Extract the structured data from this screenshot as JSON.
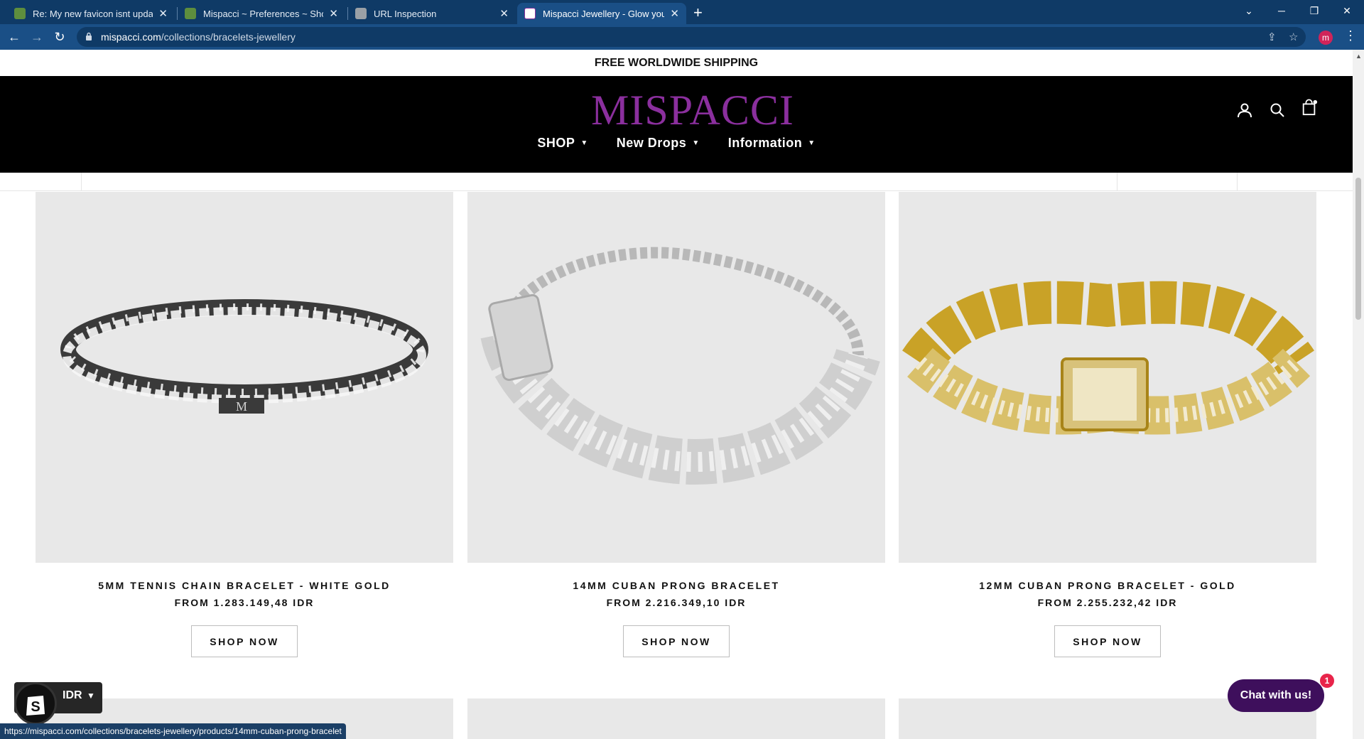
{
  "browser": {
    "tabs": [
      {
        "title": "Re: My new favicon isnt updated",
        "favicon": "shopify-icon",
        "active": false
      },
      {
        "title": "Mispacci ~ Preferences ~ Shopify",
        "favicon": "shopify-icon",
        "active": false
      },
      {
        "title": "URL Inspection",
        "favicon": "search-console-icon",
        "active": false
      },
      {
        "title": "Mispacci Jewellery - Glow your way",
        "favicon": "mispacci-icon",
        "active": true
      }
    ],
    "new_tab": "+",
    "url_host": "mispacci.com",
    "url_path": "/collections/bracelets-jewellery",
    "profile_initial": "m",
    "status_url": "https://mispacci.com/collections/bracelets-jewellery/products/14mm-cuban-prong-bracelet"
  },
  "store": {
    "announcement": "FREE WORLDWIDE SHIPPING",
    "logo": "MISPACCI",
    "brand_color": "#8b2f9e",
    "nav": [
      {
        "label": "SHOP"
      },
      {
        "label": "New Drops"
      },
      {
        "label": "Information"
      }
    ]
  },
  "products": [
    {
      "title": "5MM TENNIS CHAIN BRACELET - WHITE GOLD",
      "price": "FROM 1.283.149,48 IDR",
      "button": "SHOP NOW",
      "image": "tennis-bracelet-image"
    },
    {
      "title": "14MM CUBAN PRONG BRACELET",
      "price": "FROM 2.216.349,10 IDR",
      "button": "SHOP NOW",
      "image": "silver-cuban-bracelet-image"
    },
    {
      "title": "12MM CUBAN PRONG BRACELET - GOLD",
      "price": "FROM 2.255.232,42 IDR",
      "button": "SHOP NOW",
      "image": "gold-cuban-bracelet-image"
    }
  ],
  "widgets": {
    "currency": "IDR",
    "chat_label": "Chat with us!",
    "chat_badge": "1",
    "chat_color": "#3e0f5c"
  }
}
